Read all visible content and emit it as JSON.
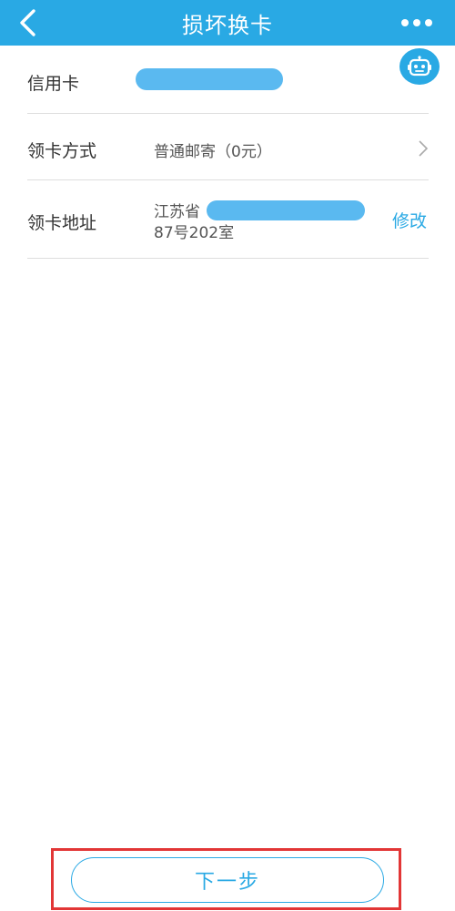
{
  "header": {
    "title": "损坏换卡",
    "back_icon": "chevron-left-icon",
    "more_icon": "more-dots-icon"
  },
  "colors": {
    "primary": "#29a9e4",
    "highlight_border": "#e23636",
    "mask": "#5ab9f0"
  },
  "rows": {
    "card": {
      "label": "信用卡"
    },
    "method": {
      "label": "领卡方式",
      "value": "普通邮寄（0元）"
    },
    "address": {
      "label": "领卡地址",
      "line1": "江苏省",
      "line2": "87号202室",
      "edit": "修改"
    }
  },
  "robot_icon": "robot-icon",
  "next_button": "下一步"
}
